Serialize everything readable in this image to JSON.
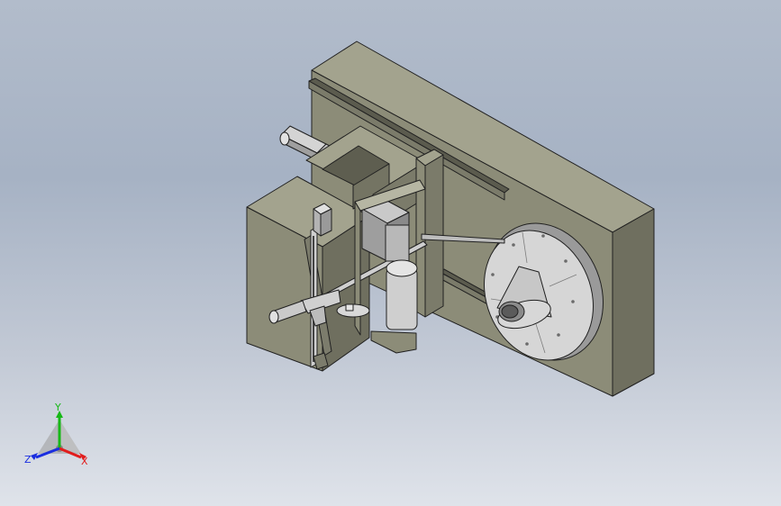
{
  "viewport": {
    "background_top": "#b2bccb",
    "background_bottom": "#dfe3ea"
  },
  "model": {
    "icon": "cad-assembly-model",
    "colors": {
      "body_front": "#8c8c78",
      "body_top": "#a3a38e",
      "body_side": "#6f6f5f",
      "edge": "#202020",
      "metal": "#d8d8d8",
      "metal_shadow": "#a9a9a9"
    }
  },
  "triad": {
    "x_label": "X",
    "y_label": "Y",
    "z_label": "Z",
    "x_color": "#e11d1d",
    "y_color": "#16b816",
    "z_color": "#1a2ee0"
  }
}
